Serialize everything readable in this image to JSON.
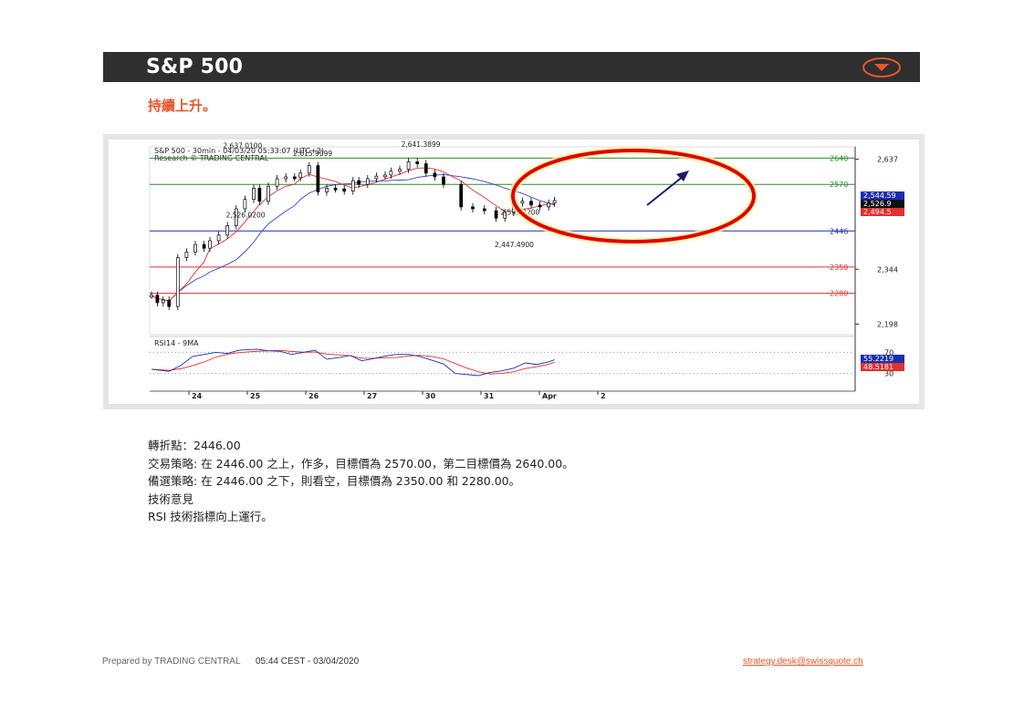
{
  "header": {
    "title": "S&P 500"
  },
  "subtitle": "持續上升。",
  "chart_data": {
    "type": "line",
    "title": "S&P 500 - 30min - 04/03/20 05:33:07 (UTC+2)",
    "subtitle": "Research © TRADING CENTRAL",
    "price_ticks": [
      2637,
      2344,
      2198
    ],
    "price_tick_labels": [
      "2,637",
      "2,344",
      "2,198"
    ],
    "x_tick_labels": [
      "24",
      "25",
      "26",
      "27",
      "30",
      "31",
      "Apr",
      "2"
    ],
    "levels": [
      {
        "label": "2640",
        "value": 2640,
        "color": "#2e8b2e"
      },
      {
        "label": "2570",
        "value": 2570,
        "color": "#2e8b2e"
      },
      {
        "label": "2446",
        "value": 2446,
        "color": "#1a2fb0"
      },
      {
        "label": "2350",
        "value": 2350,
        "color": "#e03030"
      },
      {
        "label": "2280",
        "value": 2280,
        "color": "#e03030"
      }
    ],
    "price_badges": [
      {
        "label": "2,544.59",
        "color": "#1a2fb0"
      },
      {
        "label": "2,526.9",
        "color": "#111111"
      },
      {
        "label": "2,494.5",
        "color": "#e03030"
      }
    ],
    "annotations": [
      {
        "text": "2,637.0100",
        "x": 1.35,
        "y": 2637
      },
      {
        "text": "2,615.9099",
        "x": 2.55,
        "y": 2616
      },
      {
        "text": "2,641.3899",
        "x": 4.4,
        "y": 2641
      },
      {
        "text": "2,526.0200",
        "x": 1.4,
        "y": 2526
      },
      {
        "text": "2,533.2200",
        "x": 6.1,
        "y": 2533
      },
      {
        "text": "2,447.4900",
        "x": 6.0,
        "y": 2447
      }
    ],
    "price_series": [
      [
        0.0,
        2275
      ],
      [
        0.1,
        2255
      ],
      [
        0.2,
        2262
      ],
      [
        0.3,
        2245
      ],
      [
        0.45,
        2375
      ],
      [
        0.6,
        2390
      ],
      [
        0.75,
        2410
      ],
      [
        0.9,
        2400
      ],
      [
        1.0,
        2420
      ],
      [
        1.15,
        2435
      ],
      [
        1.3,
        2460
      ],
      [
        1.45,
        2505
      ],
      [
        1.6,
        2530
      ],
      [
        1.75,
        2560
      ],
      [
        1.85,
        2525
      ],
      [
        2.0,
        2565
      ],
      [
        2.15,
        2585
      ],
      [
        2.3,
        2590
      ],
      [
        2.45,
        2588
      ],
      [
        2.55,
        2600
      ],
      [
        2.7,
        2620
      ],
      [
        2.85,
        2550
      ],
      [
        3.0,
        2560
      ],
      [
        3.15,
        2558
      ],
      [
        3.3,
        2552
      ],
      [
        3.45,
        2580
      ],
      [
        3.55,
        2570
      ],
      [
        3.7,
        2585
      ],
      [
        3.85,
        2592
      ],
      [
        4.0,
        2595
      ],
      [
        4.1,
        2605
      ],
      [
        4.25,
        2610
      ],
      [
        4.4,
        2630
      ],
      [
        4.55,
        2625
      ],
      [
        4.7,
        2600
      ],
      [
        4.85,
        2590
      ],
      [
        5.0,
        2570
      ],
      [
        5.3,
        2510
      ],
      [
        5.5,
        2505
      ],
      [
        5.7,
        2500
      ],
      [
        5.9,
        2480
      ],
      [
        6.05,
        2495
      ],
      [
        6.2,
        2520
      ],
      [
        6.35,
        2525
      ],
      [
        6.5,
        2515
      ],
      [
        6.65,
        2510
      ],
      [
        6.8,
        2520
      ],
      [
        6.9,
        2527
      ]
    ],
    "rsi": {
      "label": "RSI14 - 9MA",
      "yticks": [
        70,
        30
      ],
      "current_rsi": "55.2219",
      "current_ma": "48.5181",
      "series": [
        [
          0.0,
          38
        ],
        [
          0.3,
          34
        ],
        [
          0.5,
          45
        ],
        [
          0.7,
          62
        ],
        [
          0.9,
          66
        ],
        [
          1.1,
          70
        ],
        [
          1.3,
          68
        ],
        [
          1.5,
          74
        ],
        [
          1.8,
          76
        ],
        [
          2.0,
          73
        ],
        [
          2.2,
          72
        ],
        [
          2.4,
          66
        ],
        [
          2.6,
          70
        ],
        [
          2.8,
          74
        ],
        [
          3.0,
          57
        ],
        [
          3.2,
          60
        ],
        [
          3.4,
          64
        ],
        [
          3.6,
          54
        ],
        [
          3.8,
          58
        ],
        [
          4.0,
          63
        ],
        [
          4.2,
          66
        ],
        [
          4.4,
          66
        ],
        [
          4.6,
          62
        ],
        [
          4.8,
          55
        ],
        [
          5.0,
          48
        ],
        [
          5.2,
          30
        ],
        [
          5.4,
          28
        ],
        [
          5.6,
          26
        ],
        [
          5.8,
          32
        ],
        [
          6.0,
          35
        ],
        [
          6.2,
          40
        ],
        [
          6.4,
          50
        ],
        [
          6.6,
          47
        ],
        [
          6.8,
          52
        ],
        [
          6.9,
          56
        ]
      ]
    }
  },
  "body": {
    "lines": [
      "轉折點：2446.00",
      "交易策略: 在 2446.00 之上，作多，目標價為 2570.00，第二目標價為 2640.00。",
      "備選策略: 在 2446.00 之下，則看空，目標價為 2350.00 和 2280.00。",
      "技術意見",
      "RSI 技術指標向上運行。"
    ]
  },
  "footer": {
    "prepared_by": "Prepared by TRADING CENTRAL",
    "timestamp": "05:44 CEST - 03/04/2020",
    "email": "strategy.desk@swissquote.ch"
  },
  "colors": {
    "accent": "#e8562a",
    "header_bg": "#2f2f2f",
    "resistance": "#2e8b2e",
    "pivot": "#1a2fb0",
    "support": "#e03030",
    "highlight_circle": "#e00000"
  }
}
